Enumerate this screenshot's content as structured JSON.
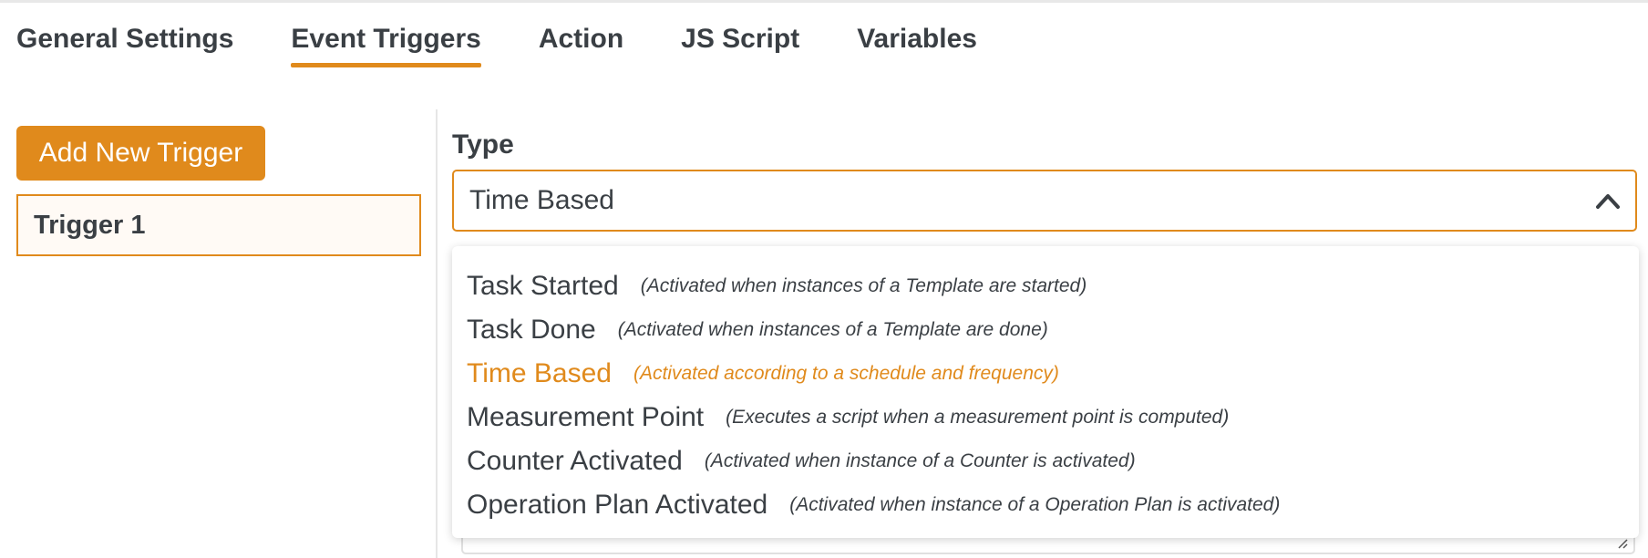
{
  "tabs": [
    {
      "label": "General Settings"
    },
    {
      "label": "Event Triggers"
    },
    {
      "label": "Action"
    },
    {
      "label": "JS Script"
    },
    {
      "label": "Variables"
    }
  ],
  "active_tab": "Event Triggers",
  "left_panel": {
    "add_button_label": "Add New Trigger",
    "triggers": [
      {
        "label": "Trigger 1"
      }
    ]
  },
  "type_field": {
    "label": "Type",
    "selected_value": "Time Based"
  },
  "dropdown": {
    "options": [
      {
        "name": "Task Started",
        "description": "(Activated when instances of a Template are started)"
      },
      {
        "name": "Task Done",
        "description": "(Activated when instances of a Template are done)"
      },
      {
        "name": "Time Based",
        "description": "(Activated according to a schedule and frequency)"
      },
      {
        "name": "Measurement Point",
        "description": "(Executes a script when a measurement point is computed)"
      },
      {
        "name": "Counter Activated",
        "description": "(Activated when instance of a Counter is activated)"
      },
      {
        "name": "Operation Plan Activated",
        "description": "(Activated when instance of a Operation Plan is activated)"
      }
    ]
  },
  "colors": {
    "accent": "#e08a1c",
    "text": "#3a3f44"
  }
}
